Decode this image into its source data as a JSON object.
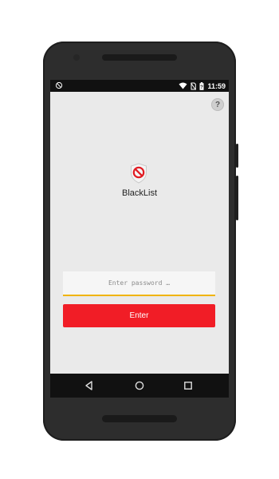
{
  "status_bar": {
    "time": "11:59",
    "left_icon": "no-notifications-icon",
    "icons": [
      "wifi-icon",
      "no-sim-icon",
      "battery-icon"
    ]
  },
  "app": {
    "title": "BlackList",
    "logo_icon": "shield-block-icon",
    "help_label": "?"
  },
  "login": {
    "password_placeholder": "Enter password …",
    "password_value": "",
    "enter_label": "Enter"
  },
  "nav_bar": {
    "buttons": [
      "back-icon",
      "home-icon",
      "recents-icon"
    ]
  },
  "colors": {
    "accent": "#f11d26",
    "input_underline": "#f0b400",
    "screen_bg": "#eaeaea",
    "phone_body": "#2d2d2d"
  }
}
